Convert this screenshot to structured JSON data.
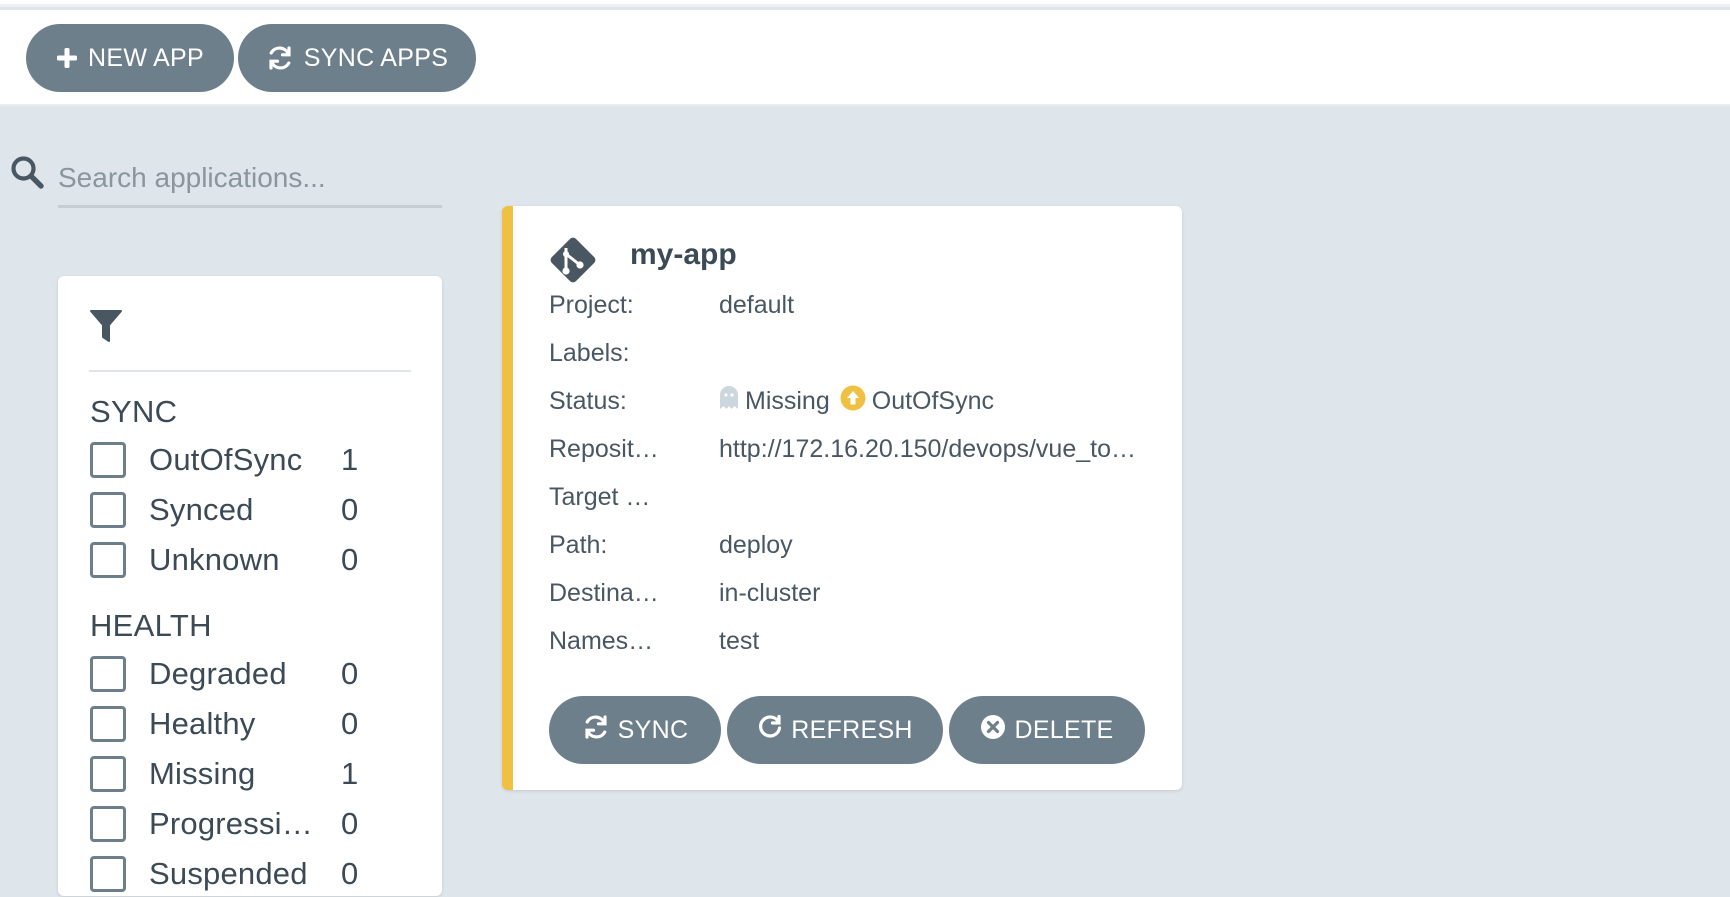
{
  "toolbar": {
    "new_app_label": "NEW APP",
    "sync_apps_label": "SYNC APPS"
  },
  "search": {
    "placeholder": "Search applications..."
  },
  "filters": {
    "sync": {
      "title": "SYNC",
      "items": [
        {
          "label": "OutOfSync",
          "count": "1"
        },
        {
          "label": "Synced",
          "count": "0"
        },
        {
          "label": "Unknown",
          "count": "0"
        }
      ]
    },
    "health": {
      "title": "HEALTH",
      "items": [
        {
          "label": "Degraded",
          "count": "0"
        },
        {
          "label": "Healthy",
          "count": "0"
        },
        {
          "label": "Missing",
          "count": "1"
        },
        {
          "label": "Progressi…",
          "count": "0"
        },
        {
          "label": "Suspended",
          "count": "0"
        }
      ]
    }
  },
  "app": {
    "name": "my-app",
    "accent_color": "#f0c042",
    "fields": {
      "project": {
        "key": "Project:",
        "value": "default"
      },
      "labels": {
        "key": "Labels:",
        "value": ""
      },
      "status": {
        "key": "Status:",
        "health": "Missing",
        "sync": "OutOfSync"
      },
      "repository": {
        "key": "Reposit…",
        "value": "http://172.16.20.150/devops/vue_to…"
      },
      "target": {
        "key": "Target …",
        "value": ""
      },
      "path": {
        "key": "Path:",
        "value": "deploy"
      },
      "destination": {
        "key": "Destina…",
        "value": "in-cluster"
      },
      "namespace": {
        "key": "Names…",
        "value": "test"
      }
    },
    "actions": {
      "sync_label": "SYNC",
      "refresh_label": "REFRESH",
      "delete_label": "DELETE"
    }
  },
  "colors": {
    "button_bg": "#6d7f8b",
    "page_bg": "#dee6eb",
    "out_of_sync": "#f0c042",
    "missing": "#ccd6dd"
  },
  "icons": {
    "new_app": "plus-icon",
    "sync_apps": "sync-icon",
    "search": "search-icon",
    "filter": "filter-icon",
    "app": "git-icon",
    "missing": "ghost-icon",
    "out_of_sync": "arrow-up-circle-icon",
    "refresh": "refresh-icon",
    "delete": "times-circle-icon"
  }
}
